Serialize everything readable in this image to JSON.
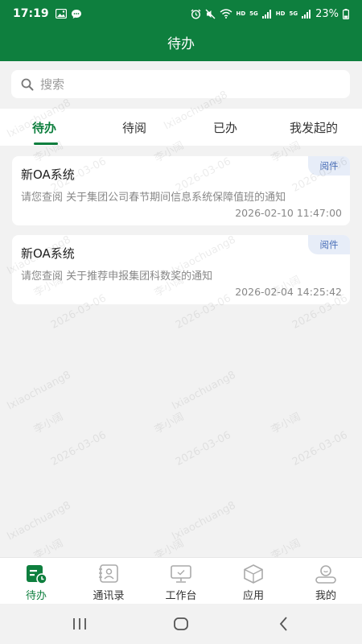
{
  "status_bar": {
    "time": "17:19",
    "net_label_1": "HD",
    "net_label_2": "HD",
    "signal_1": "5G",
    "signal_2": "5G",
    "battery": "23%"
  },
  "header": {
    "title": "待办"
  },
  "search": {
    "placeholder": "搜索"
  },
  "tabs": [
    {
      "label": "待办",
      "active": true
    },
    {
      "label": "待阅",
      "active": false
    },
    {
      "label": "已办",
      "active": false
    },
    {
      "label": "我发起的",
      "active": false
    }
  ],
  "cards": [
    {
      "title": "新OA系统",
      "badge": "阅件",
      "desc": "请您查阅 关于集团公司春节期间信息系统保障值班的通知",
      "time": "2026-02-10 11:47:00"
    },
    {
      "title": "新OA系统",
      "badge": "阅件",
      "desc": "请您查阅 关于推荐申报集团科数奖的通知",
      "time": "2026-02-04 14:25:42"
    }
  ],
  "watermark": {
    "user": "李小阔",
    "account": "lxiaochuang8",
    "date": "2026-03-06"
  },
  "bottom_nav": [
    {
      "label": "待办",
      "icon": "todo-icon",
      "active": true
    },
    {
      "label": "通讯录",
      "icon": "contacts-icon",
      "active": false
    },
    {
      "label": "工作台",
      "icon": "workbench-icon",
      "active": false
    },
    {
      "label": "应用",
      "icon": "apps-icon",
      "active": false
    },
    {
      "label": "我的",
      "icon": "profile-icon",
      "active": false
    }
  ],
  "colors": {
    "brand": "#0e7f3e",
    "badge_bg": "#e7edf8",
    "badge_text": "#4a6fb8"
  }
}
